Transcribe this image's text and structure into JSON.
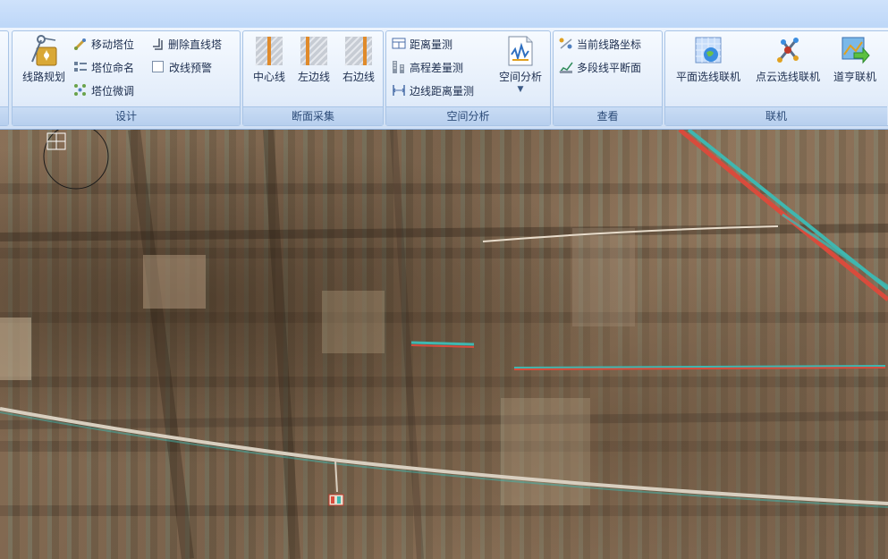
{
  "ribbon": {
    "groups": {
      "design": {
        "label": "设计",
        "route_plan": "线路规划",
        "move_tower": "移动塔位",
        "name_tower": "塔位命名",
        "fine_tune_tower": "塔位微调",
        "delete_line_tower": "删除直线塔",
        "reroute_warning": "改线预警"
      },
      "section": {
        "label": "断面采集",
        "center_line": "中心线",
        "left_line": "左边线",
        "right_line": "右边线"
      },
      "spatial": {
        "label": "空间分析",
        "distance": "距离量测",
        "elevation": "高程差量测",
        "edge_distance": "边线距离量测",
        "analysis": "空间分析"
      },
      "view": {
        "label": "查看",
        "current_coords": "当前线路坐标",
        "multi_plan": "多段线平断面"
      },
      "link": {
        "label": "联机",
        "plane_select": "平面选线联机",
        "cloud_select": "点云选线联机",
        "daoheng_link": "道亨联机"
      }
    }
  },
  "colors": {
    "ribbon_border": "#a8c4e6",
    "label_bg": "#bcd2ef",
    "road": "#d8cfc0",
    "river_red": "#d94b3c",
    "river_cyan": "#3fb7b0"
  }
}
